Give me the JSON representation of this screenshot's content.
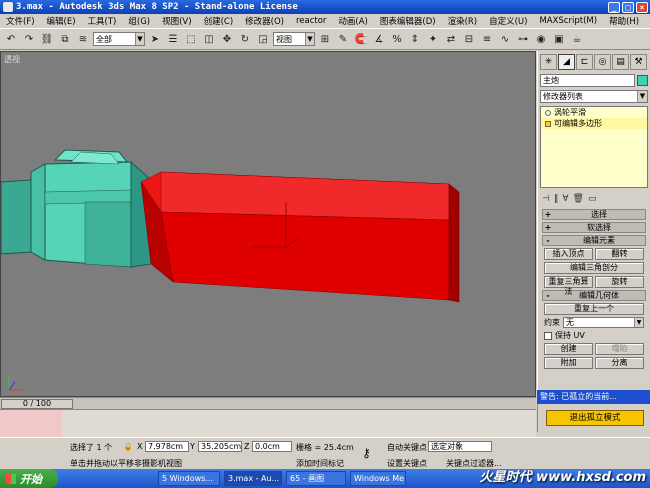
{
  "window": {
    "title": "3.max - Autodesk 3ds Max 8 SP2 - Stand-alone License",
    "min": "_",
    "max": "□",
    "close": "×"
  },
  "menu": [
    "文件(F)",
    "编辑(E)",
    "工具(T)",
    "组(G)",
    "视图(V)",
    "创建(C)",
    "修改器(O)",
    "reactor",
    "动画(A)",
    "图表编辑器(D)",
    "渲染(R)",
    "自定义(U)",
    "MAXScript(M)",
    "帮助(H)"
  ],
  "toolbar": {
    "selection_filter": "全部",
    "ref_coord": "视图"
  },
  "viewport": {
    "label": "透视"
  },
  "command_panel": {
    "object_name": "主炮",
    "object_color": "#40d0b0",
    "modifier_list": "修改器列表",
    "stack": [
      {
        "label": "涡轮平滑",
        "selected": false,
        "icon": "light-bulb-icon"
      },
      {
        "label": "可编辑多边形",
        "selected": true,
        "icon": "editable-poly-icon"
      }
    ],
    "rollouts": {
      "selection": "选择",
      "soft_selection": "软选择",
      "edit_elements": "编辑元素",
      "edit_geometry": "编辑几何体"
    },
    "buttons": {
      "insert_vertex": "插入顶点",
      "flip": "翻转",
      "edit_triangulation": "编辑三角剖分",
      "retriangulate": "重复三角算法",
      "turn": "旋转",
      "repeat_last": "重复上一个",
      "create": "创建",
      "collapse": "塌陷",
      "attach": "附加",
      "detach": "分离"
    },
    "constraints_label": "约束",
    "constraints_value": "无",
    "preserve_uv": "保持 UV"
  },
  "warning": {
    "title": "警告: 已孤立的当前...",
    "exit_button": "退出孤立模式"
  },
  "timeline": {
    "frame": "0 / 100"
  },
  "status": {
    "selected": "选择了 1 个",
    "prompt": "单击并拖动以平移非摄影机视图",
    "x_label": "X",
    "x_value": "7.978cm",
    "y_label": "Y",
    "y_value": "35.205cm",
    "z_label": "Z",
    "z_value": "0.0cm",
    "grid": "栅格 = 25.4cm",
    "add_time_tag": "添加时间标记",
    "auto_key": "自动关键点",
    "set_key": "设置关键点",
    "selected_obj": "选定对象",
    "key_filters": "关键点过滤器..."
  },
  "taskbar": {
    "start": "开始",
    "items": [
      "5 Windows...",
      "3.max - Au...",
      "65 - 画图",
      "Windows Me..."
    ],
    "watermark": "火星时代 www.hxsd.com"
  }
}
